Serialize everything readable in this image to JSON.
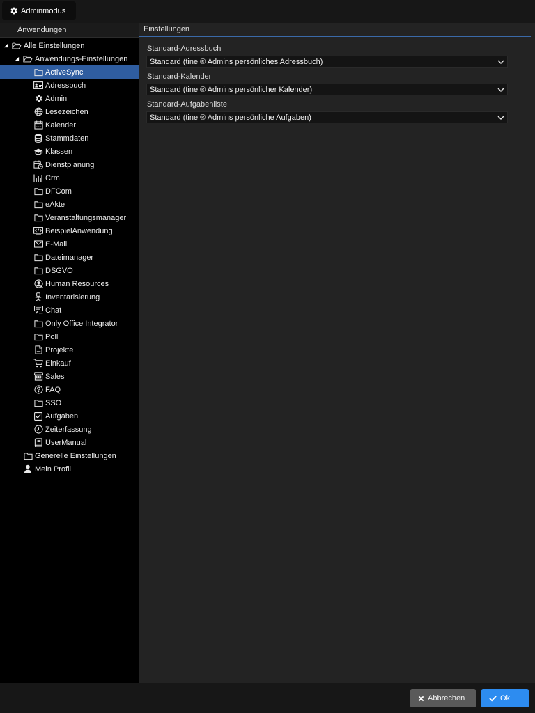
{
  "topbar": {
    "admin_label": "Adminmodus",
    "admin_icon": "gear-icon"
  },
  "left_panel": {
    "header": "Anwendungen"
  },
  "tree": [
    {
      "label": "Alle Einstellungen",
      "icon": "folder-open-icon",
      "level": 0,
      "expanded": true
    },
    {
      "label": "Anwendungs-Einstellungen",
      "icon": "folder-open-icon",
      "level": 1,
      "expanded": true
    },
    {
      "label": "ActiveSync",
      "icon": "folder-icon",
      "level": 2,
      "selected": true
    },
    {
      "label": "Adressbuch",
      "icon": "address-card-icon",
      "level": 2
    },
    {
      "label": "Admin",
      "icon": "gear-icon",
      "level": 2
    },
    {
      "label": "Lesezeichen",
      "icon": "globe-icon",
      "level": 2
    },
    {
      "label": "Kalender",
      "icon": "calendar-icon",
      "level": 2
    },
    {
      "label": "Stammdaten",
      "icon": "database-icon",
      "level": 2
    },
    {
      "label": "Klassen",
      "icon": "graduation-cap-icon",
      "level": 2
    },
    {
      "label": "Dienstplanung",
      "icon": "calendar-clock-icon",
      "level": 2
    },
    {
      "label": "Crm",
      "icon": "bar-chart-icon",
      "level": 2
    },
    {
      "label": "DFCom",
      "icon": "folder-icon",
      "level": 2
    },
    {
      "label": "eAkte",
      "icon": "folder-icon",
      "level": 2
    },
    {
      "label": "Veranstaltungsmanager",
      "icon": "folder-icon",
      "level": 2
    },
    {
      "label": "BeispielAnwendung",
      "icon": "code-window-icon",
      "level": 2
    },
    {
      "label": "E-Mail",
      "icon": "envelope-icon",
      "level": 2
    },
    {
      "label": "Dateimanager",
      "icon": "folder-icon",
      "level": 2
    },
    {
      "label": "DSGVO",
      "icon": "folder-icon",
      "level": 2
    },
    {
      "label": "Human Resources",
      "icon": "user-search-icon",
      "level": 2
    },
    {
      "label": "Inventarisierung",
      "icon": "office-chair-icon",
      "level": 2
    },
    {
      "label": "Chat",
      "icon": "chat-icon",
      "level": 2
    },
    {
      "label": "Only Office Integrator",
      "icon": "folder-icon",
      "level": 2
    },
    {
      "label": "Poll",
      "icon": "folder-icon",
      "level": 2
    },
    {
      "label": "Projekte",
      "icon": "document-icon",
      "level": 2
    },
    {
      "label": "Einkauf",
      "icon": "cart-icon",
      "level": 2
    },
    {
      "label": "Sales",
      "icon": "store-icon",
      "level": 2
    },
    {
      "label": "FAQ",
      "icon": "question-circle-icon",
      "level": 2
    },
    {
      "label": "SSO",
      "icon": "folder-icon",
      "level": 2
    },
    {
      "label": "Aufgaben",
      "icon": "checkbox-icon",
      "level": 2
    },
    {
      "label": "Zeiterfassung",
      "icon": "clock-icon",
      "level": 2
    },
    {
      "label": "UserManual",
      "icon": "book-icon",
      "level": 2
    },
    {
      "label": "Generelle Einstellungen",
      "icon": "folder-icon",
      "level": 1
    },
    {
      "label": "Mein Profil",
      "icon": "user-icon",
      "level": 1
    }
  ],
  "settings": {
    "header": "Einstellungen",
    "fields": [
      {
        "label": "Standard-Adressbuch",
        "value": "Standard (tine ® Admins persönliches Adressbuch)"
      },
      {
        "label": "Standard-Kalender",
        "value": "Standard (tine ® Admins persönlicher Kalender)"
      },
      {
        "label": "Standard-Aufgabenliste",
        "value": "Standard (tine ® Admins persönliche Aufgaben)"
      }
    ]
  },
  "footer": {
    "cancel_label": "Abbrechen",
    "ok_label": "Ok"
  }
}
